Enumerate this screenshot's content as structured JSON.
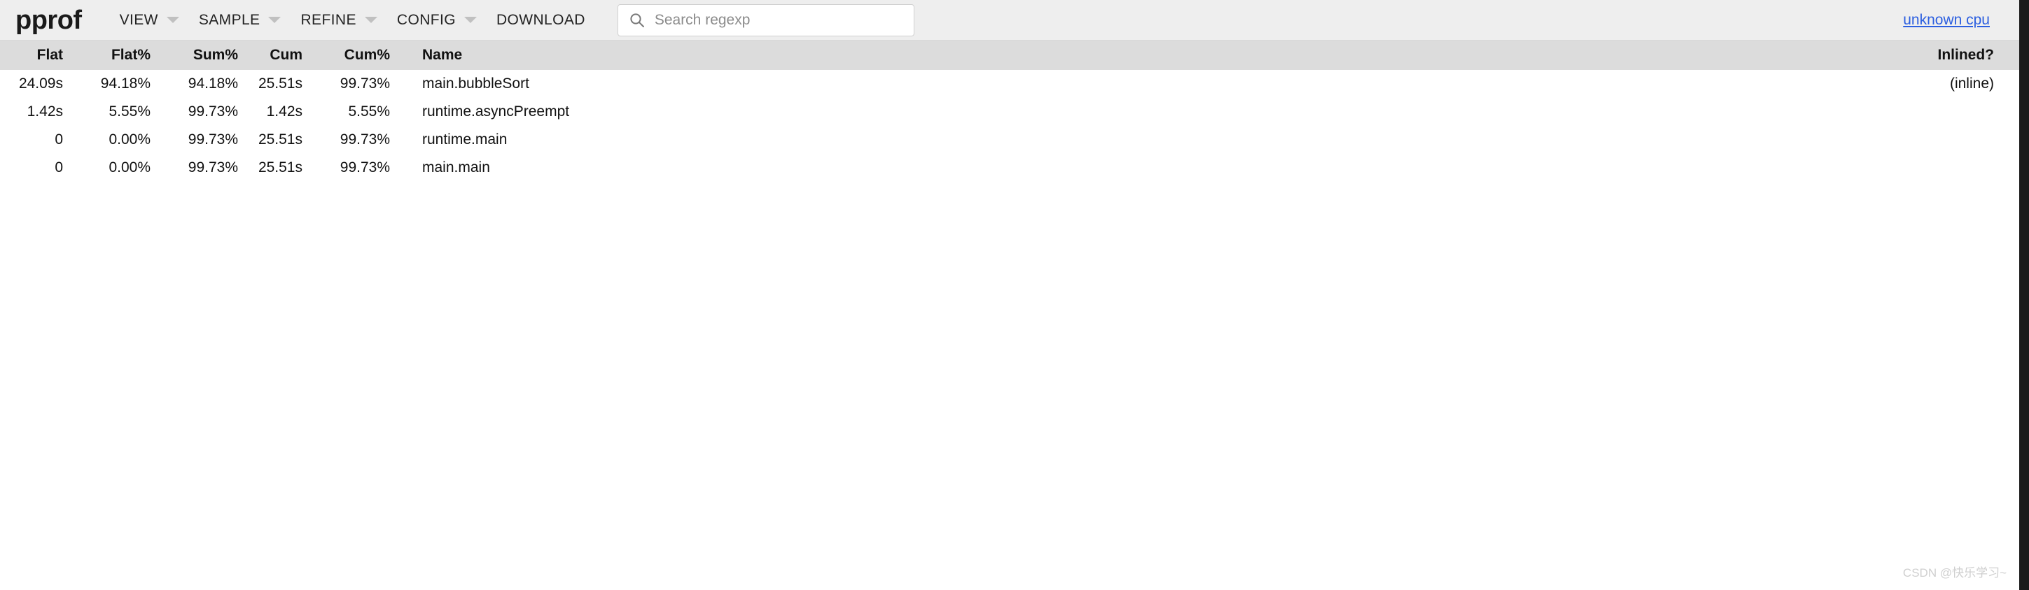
{
  "app": {
    "brand": "pprof",
    "profile_link": "unknown cpu",
    "watermark": "CSDN @快乐学习~"
  },
  "menu": {
    "items": [
      {
        "label": "VIEW",
        "has_caret": true
      },
      {
        "label": "SAMPLE",
        "has_caret": true
      },
      {
        "label": "REFINE",
        "has_caret": true
      },
      {
        "label": "CONFIG",
        "has_caret": true
      },
      {
        "label": "DOWNLOAD",
        "has_caret": false
      }
    ]
  },
  "search": {
    "placeholder": "Search regexp",
    "value": "",
    "icon": "search-icon"
  },
  "table": {
    "columns": [
      "Flat",
      "Flat%",
      "Sum%",
      "Cum",
      "Cum%",
      "Name",
      "Inlined?"
    ],
    "rows": [
      {
        "flat": "24.09s",
        "flat_pct": "94.18%",
        "sum_pct": "94.18%",
        "cum": "25.51s",
        "cum_pct": "99.73%",
        "name": "main.bubbleSort",
        "inlined": "(inline)"
      },
      {
        "flat": "1.42s",
        "flat_pct": "5.55%",
        "sum_pct": "99.73%",
        "cum": "1.42s",
        "cum_pct": "5.55%",
        "name": "runtime.asyncPreempt",
        "inlined": ""
      },
      {
        "flat": "0",
        "flat_pct": "0.00%",
        "sum_pct": "99.73%",
        "cum": "25.51s",
        "cum_pct": "99.73%",
        "name": "runtime.main",
        "inlined": ""
      },
      {
        "flat": "0",
        "flat_pct": "0.00%",
        "sum_pct": "99.73%",
        "cum": "25.51s",
        "cum_pct": "99.73%",
        "name": "main.main",
        "inlined": ""
      }
    ]
  },
  "colors": {
    "header_bg": "#eeeeee",
    "table_header_bg": "#dcdcdc",
    "link": "#2c5fe0",
    "text": "#111111",
    "page_bg": "#ffffff"
  }
}
